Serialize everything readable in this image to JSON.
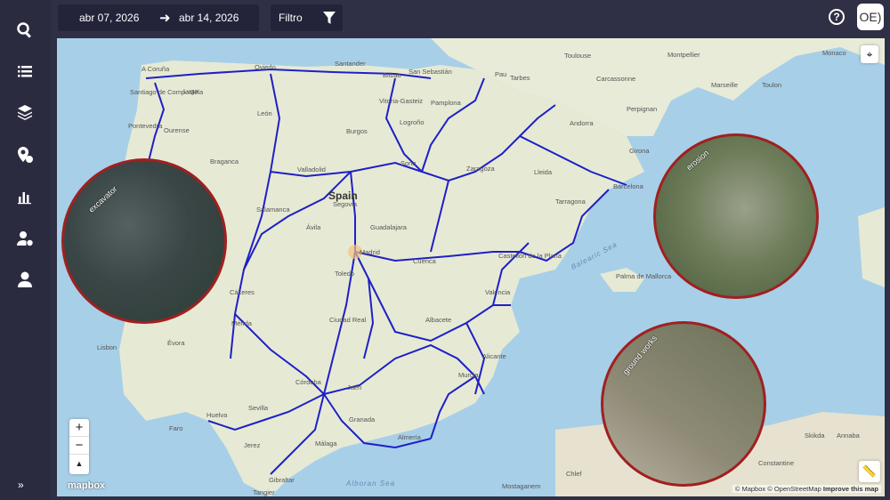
{
  "topbar": {
    "date_from": "abr 07, 2026",
    "date_to": "abr 14, 2026",
    "filter_label": "Filtro",
    "logo_text": "OE)"
  },
  "sidebar": {
    "items": [
      {
        "icon": "search-icon"
      },
      {
        "icon": "list-icon"
      },
      {
        "icon": "layers-icon"
      },
      {
        "icon": "location-settings-icon"
      },
      {
        "icon": "bar-chart-icon"
      },
      {
        "icon": "user-settings-icon"
      },
      {
        "icon": "user-icon"
      }
    ],
    "collapse_icon": "double-chevron-right-icon"
  },
  "map": {
    "country_label": "Spain",
    "cities": [
      "A Coruña",
      "Oviedo",
      "Santander",
      "Bilbao",
      "San Sebastián",
      "Pau",
      "Tarbes",
      "Toulouse",
      "Montpellier",
      "Monaco",
      "Marseille",
      "Toulon",
      "Carcassonne",
      "Perpignan",
      "Andorra",
      "Girona",
      "Barcelona",
      "Tarragona",
      "Lleida",
      "Zaragoza",
      "Pamplona",
      "Logroño",
      "Vitoria-Gasteiz",
      "Burgos",
      "Soria",
      "León",
      "Lugo",
      "Santiago de Compostela",
      "Pontevedra",
      "Ourense",
      "Braganca",
      "Valladolid",
      "Salamanca",
      "Ávila",
      "Segovia",
      "Guadalajara",
      "Madrid",
      "Cuenca",
      "Toledo",
      "Castellón de la Plana",
      "Valencia",
      "Palma de Mallorca",
      "Albacete",
      "Alicante",
      "Murcia",
      "Ciudad Real",
      "Cáceres",
      "Mérida",
      "Lisbon",
      "Évora",
      "Faro",
      "Huelva",
      "Sevilla",
      "Córdoba",
      "Jaén",
      "Granada",
      "Almería",
      "Málaga",
      "Jerez",
      "Gibraltar",
      "Tangier",
      "Mostaganem",
      "Chlef",
      "Skikda",
      "Constantine",
      "Annaba"
    ],
    "seas": [
      "Balearic Sea",
      "Alboran Sea"
    ],
    "attribution": "© Mapbox © OpenStreetMap",
    "improve_link": "Improve this map",
    "mapbox_logo": "mapbox",
    "zoom_in": "+",
    "zoom_out": "−"
  },
  "detections": [
    {
      "label": "excavator"
    },
    {
      "label": "erosion"
    },
    {
      "label": "ground works"
    }
  ],
  "colors": {
    "route": "#1f1fc8",
    "circle_border": "#a02020",
    "sidebar_bg": "#2b2b40"
  }
}
